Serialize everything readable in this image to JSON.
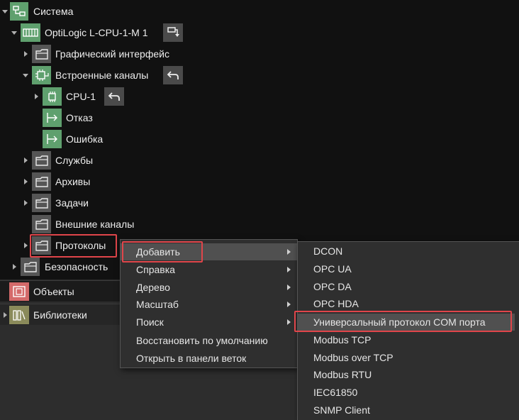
{
  "tree": {
    "items": [
      {
        "label": "Система"
      },
      {
        "label": "OptiLogic L-CPU-1-M 1"
      },
      {
        "label": "Графический интерфейс"
      },
      {
        "label": "Встроенные каналы"
      },
      {
        "label": "CPU-1"
      },
      {
        "label": "Отказ"
      },
      {
        "label": "Ошибка"
      },
      {
        "label": "Службы"
      },
      {
        "label": "Архивы"
      },
      {
        "label": "Задачи"
      },
      {
        "label": "Внешние каналы"
      },
      {
        "label": "Протоколы"
      },
      {
        "label": "Безопасность"
      }
    ]
  },
  "sections": {
    "objects": "Объекты",
    "libraries": "Библиотеки"
  },
  "context_menu": {
    "items": [
      {
        "label": "Добавить"
      },
      {
        "label": "Справка"
      },
      {
        "label": "Дерево"
      },
      {
        "label": "Масштаб"
      },
      {
        "label": "Поиск"
      },
      {
        "label": "Восстановить по умолчанию"
      },
      {
        "label": "Открыть в панели веток"
      }
    ]
  },
  "submenu": {
    "items": [
      {
        "label": "DCON"
      },
      {
        "label": "OPC UA"
      },
      {
        "label": "OPC DA"
      },
      {
        "label": "OPC HDA"
      },
      {
        "label": "Универсальный протокол COM порта"
      },
      {
        "label": "Modbus TCP"
      },
      {
        "label": "Modbus over TCP"
      },
      {
        "label": "Modbus RTU"
      },
      {
        "label": "IEC61850"
      },
      {
        "label": "SNMP Client"
      }
    ]
  },
  "colors": {
    "accent_green": "#5fa06e",
    "highlight_red": "#e0454a"
  }
}
